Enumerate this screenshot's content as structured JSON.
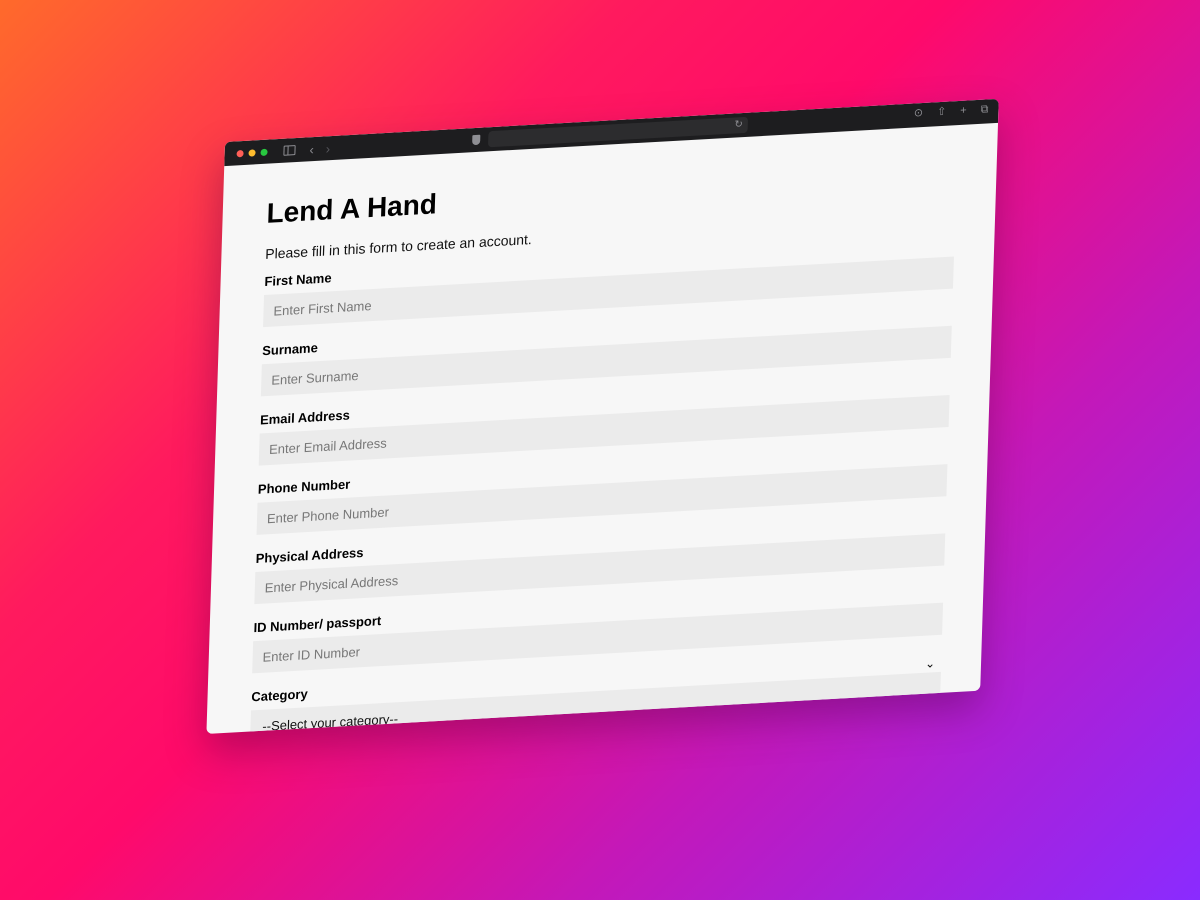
{
  "page": {
    "title": "Lend A Hand",
    "intro": "Please fill in this form to create an account."
  },
  "form": {
    "fields": [
      {
        "label": "First Name",
        "placeholder": "Enter First Name"
      },
      {
        "label": "Surname",
        "placeholder": "Enter Surname"
      },
      {
        "label": "Email Address",
        "placeholder": "Enter Email Address"
      },
      {
        "label": "Phone Number",
        "placeholder": "Enter Phone Number"
      },
      {
        "label": "Physical Address",
        "placeholder": "Enter Physical Address"
      },
      {
        "label": "ID Number/ passport",
        "placeholder": "Enter ID Number"
      }
    ],
    "category": {
      "label": "Category",
      "selected": "--Select your category--"
    }
  },
  "browser": {
    "icons": [
      "sidebar-icon",
      "back-icon",
      "forward-icon",
      "shield-icon",
      "reload-icon",
      "download-icon",
      "share-icon",
      "new-tab-icon",
      "tabs-overview-icon"
    ]
  }
}
